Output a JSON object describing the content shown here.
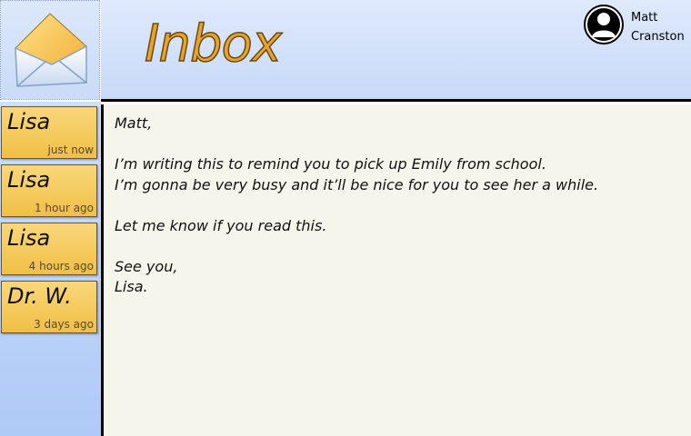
{
  "header": {
    "title": "Inbox"
  },
  "user": {
    "name": "Matt\nCranston",
    "avatar_icon": "user-silhouette-icon"
  },
  "app": {
    "logo_icon": "envelope-icon"
  },
  "messages": [
    {
      "from": "Lisa",
      "time": "just now"
    },
    {
      "from": "Lisa",
      "time": "1 hour ago"
    },
    {
      "from": "Lisa",
      "time": "4 hours ago"
    },
    {
      "from": "Dr. W.",
      "time": "3 days ago"
    }
  ],
  "reader": {
    "lines": [
      "Matt,",
      "",
      "I’m writing this to remind you to pick up Emily from school.",
      "I’m gonna be very busy and it’ll be nice for you to see her a while.",
      "",
      "Let me know if you read this.",
      "",
      "See you,",
      "Lisa."
    ]
  },
  "colors": {
    "header_bg": "#d6e4fb",
    "title": "#e8a32c",
    "message_item": "#f3c85a",
    "reader_bg": "#f6f5ec"
  }
}
